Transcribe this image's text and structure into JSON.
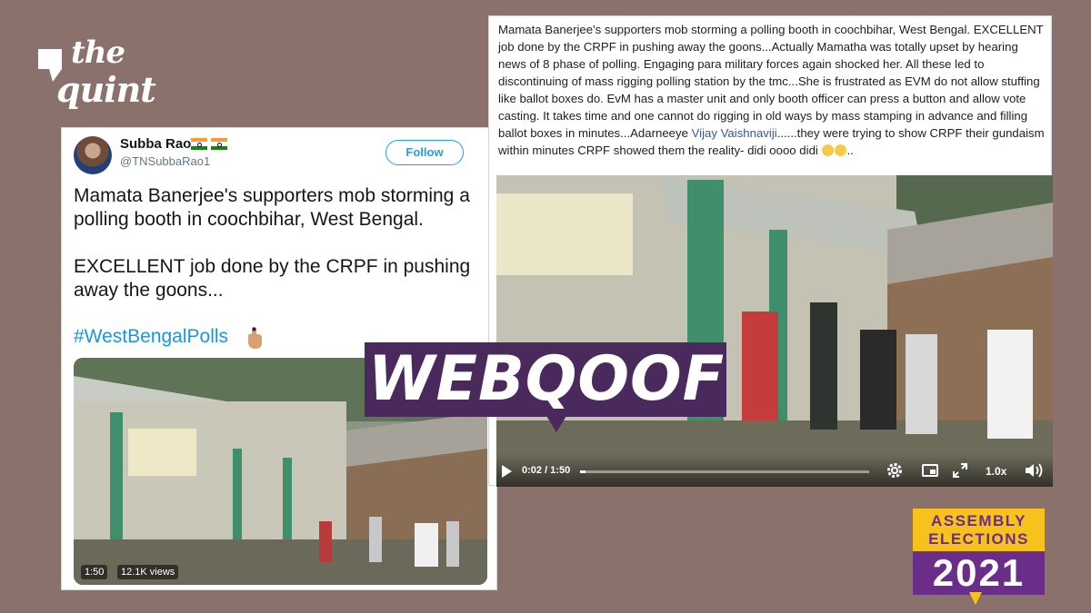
{
  "brand": {
    "logo_line1": "the",
    "logo_line2": "quint"
  },
  "tweet": {
    "user_name": "Subba Rao",
    "handle": "@TNSubbaRao1",
    "follow_label": "Follow",
    "text_para1": "Mamata Banerjee's supporters mob storming a polling booth in coochbihar, West Bengal.",
    "text_para2": "EXCELLENT job done by the CRPF in pushing away the goons...",
    "hashtag": "#WestBengalPolls",
    "video_duration": "1:50",
    "video_views": "12.1K views"
  },
  "fb_post": {
    "text_before_link": "Mamata Banerjee's supporters mob storming a polling booth in coochbihar, West Bengal. EXCELLENT job done by the CRPF in pushing away the goons...Actually Mamatha was totally upset by hearing news of 8 phase of polling. Engaging para military forces again shocked her. All these led to discontinuing of mass rigging polling station by the tmc...She is frustrated as EVM do not allow stuffing like ballot boxes do. EvM has a master unit and only booth officer can press a button and allow vote casting. It takes time and one cannot do rigging in old ways by mass stamping in advance and filling ballot boxes in minutes...Adarneeye",
    "link_text": "Vijay Vaishnaviji",
    "text_after_link": "......they were trying to show CRPF their gundaism within minutes CRPF showed them the reality- didi oooo didi",
    "text_end": "..",
    "video_time": "0:02 / 1:50",
    "video_progress": 0.02,
    "speed_label": "1.0x"
  },
  "banner": {
    "label": "WEBQOOF"
  },
  "badge": {
    "line1": "ASSEMBLY",
    "line2": "ELECTIONS",
    "year": "2021"
  },
  "colors": {
    "background": "#8a716b",
    "banner": "#4a2a5c",
    "badge_yellow": "#f6c21b",
    "badge_purple": "#6a2d8a",
    "twitter_blue": "#1da1f2"
  }
}
